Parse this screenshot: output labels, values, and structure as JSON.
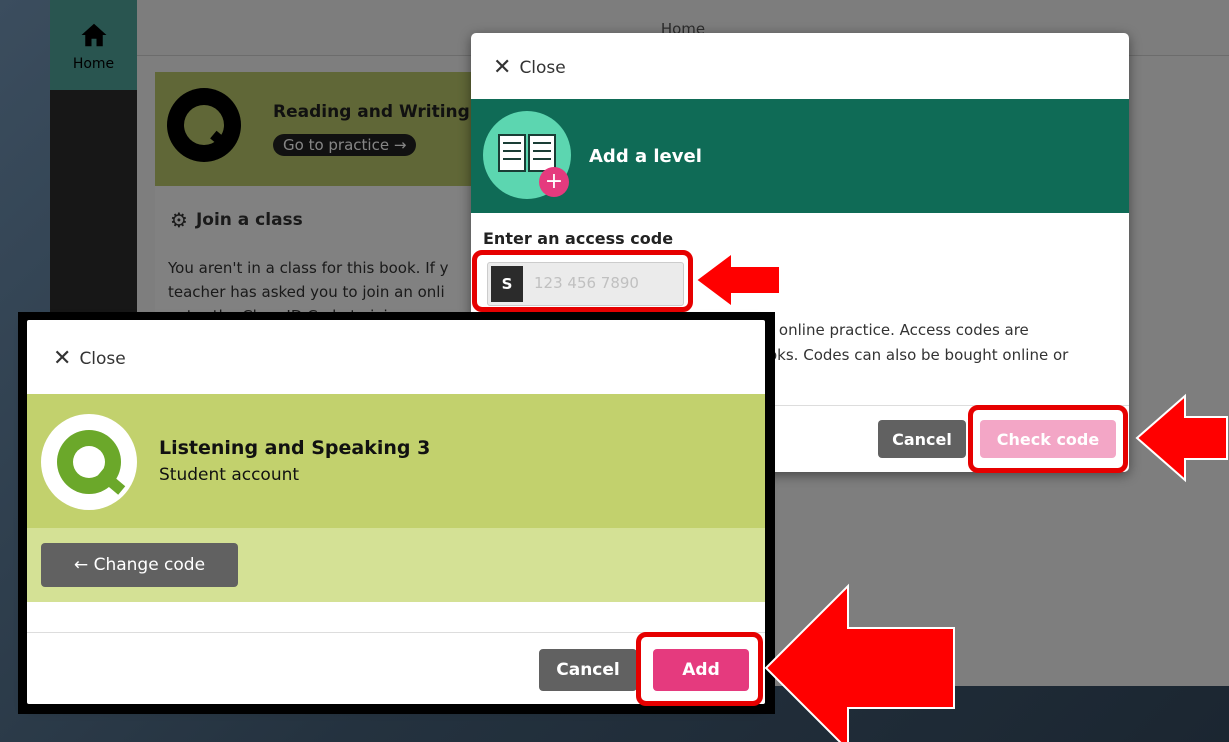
{
  "background": {
    "nav_home_label": "Home",
    "topbar_title": "Home",
    "book_title": "Reading and Writing",
    "go_to_practice": "Go to practice →",
    "join_class_heading": "Join a class",
    "join_class_text_1": "You aren't in a class for this book. If y",
    "join_class_text_2": "teacher has asked you to join an onli",
    "join_class_text_3": "enter the Class ID Code to join."
  },
  "add_level_modal": {
    "close_label": "Close",
    "header_title": "Add a level",
    "access_code_label": "Enter an access code",
    "code_prefix": "S",
    "code_placeholder": "123 456 7890",
    "info_line_1": "r online practice. Access codes are",
    "info_line_2": "oks. Codes can also be bought online or",
    "cancel_label": "Cancel",
    "check_code_label": "Check code"
  },
  "confirm_modal": {
    "close_label": "Close",
    "level_name": "Listening and Speaking 3",
    "account_type": "Student account",
    "change_code_label": "← Change code",
    "cancel_label": "Cancel",
    "add_label": "Add"
  },
  "colors": {
    "teal_header": "#0f6b56",
    "olive": "#c2d16d",
    "olive_light": "#d4e195",
    "pink": "#e53a7e",
    "pink_disabled": "#f3a6c6",
    "highlight_red": "#e60000"
  }
}
